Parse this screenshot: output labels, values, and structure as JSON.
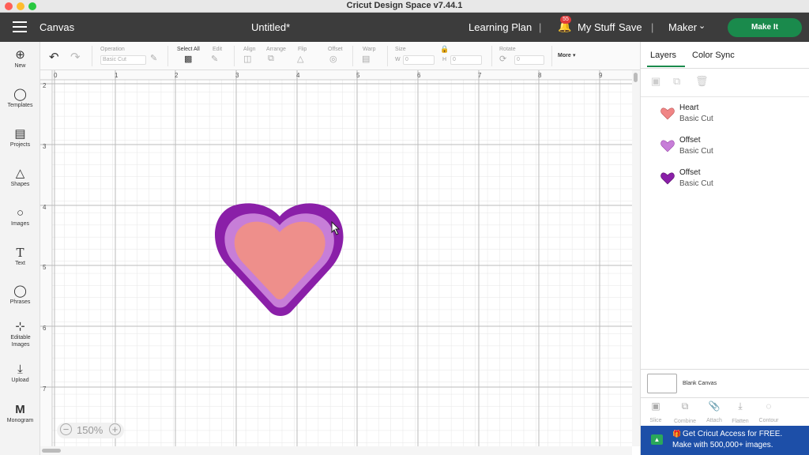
{
  "window": {
    "title": "Cricut Design Space  v7.44.1"
  },
  "header": {
    "section": "Canvas",
    "doc_title": "Untitled*",
    "learning_plan": "Learning Plan",
    "notif_count": "55",
    "my_stuff": "My Stuff",
    "save": "Save",
    "machine": "Maker",
    "make_it": "Make It"
  },
  "toolbar": {
    "operation_label": "Operation",
    "operation_value": "Basic Cut",
    "select_all": "Select All",
    "edit": "Edit",
    "align": "Align",
    "arrange": "Arrange",
    "flip": "Flip",
    "offset": "Offset",
    "warp": "Warp",
    "size": "Size",
    "w_label": "W",
    "w_value": "0",
    "h_label": "H",
    "h_value": "0",
    "rotate": "Rotate",
    "rotate_value": "0",
    "more": "More"
  },
  "sidebar": {
    "items": [
      {
        "label": "New"
      },
      {
        "label": "Templates"
      },
      {
        "label": "Projects"
      },
      {
        "label": "Shapes"
      },
      {
        "label": "Images"
      },
      {
        "label": "Text"
      },
      {
        "label": "Phrases"
      },
      {
        "label": "Editable Images"
      },
      {
        "label": "Upload"
      },
      {
        "label": "Monogram"
      }
    ]
  },
  "ruler": {
    "top": [
      "0",
      "1",
      "2",
      "3",
      "4",
      "5",
      "6",
      "7",
      "8",
      "9"
    ],
    "left": [
      "2",
      "3",
      "4",
      "5",
      "6",
      "7"
    ]
  },
  "zoom": "150%",
  "panel": {
    "tabs": [
      "Layers",
      "Color Sync"
    ],
    "layers": [
      {
        "name": "Heart",
        "op": "Basic Cut",
        "color": "#f08585"
      },
      {
        "name": "Offset",
        "op": "Basic Cut",
        "color": "#c77ed8"
      },
      {
        "name": "Offset",
        "op": "Basic Cut",
        "color": "#8a1fa8"
      }
    ],
    "blank_canvas": "Blank Canvas",
    "actions": [
      "Slice",
      "Combine",
      "Attach",
      "Flatten",
      "Contour"
    ],
    "promo_line1": "Get Cricut Access for FREE.",
    "promo_line2": "Make with 500,000+ images."
  },
  "colors": {
    "outer": "#8a1fa8",
    "middle": "#c77ed8",
    "inner": "#ee8f8b",
    "make_it": "#1a8a4c",
    "promo": "#1d4fa8"
  }
}
